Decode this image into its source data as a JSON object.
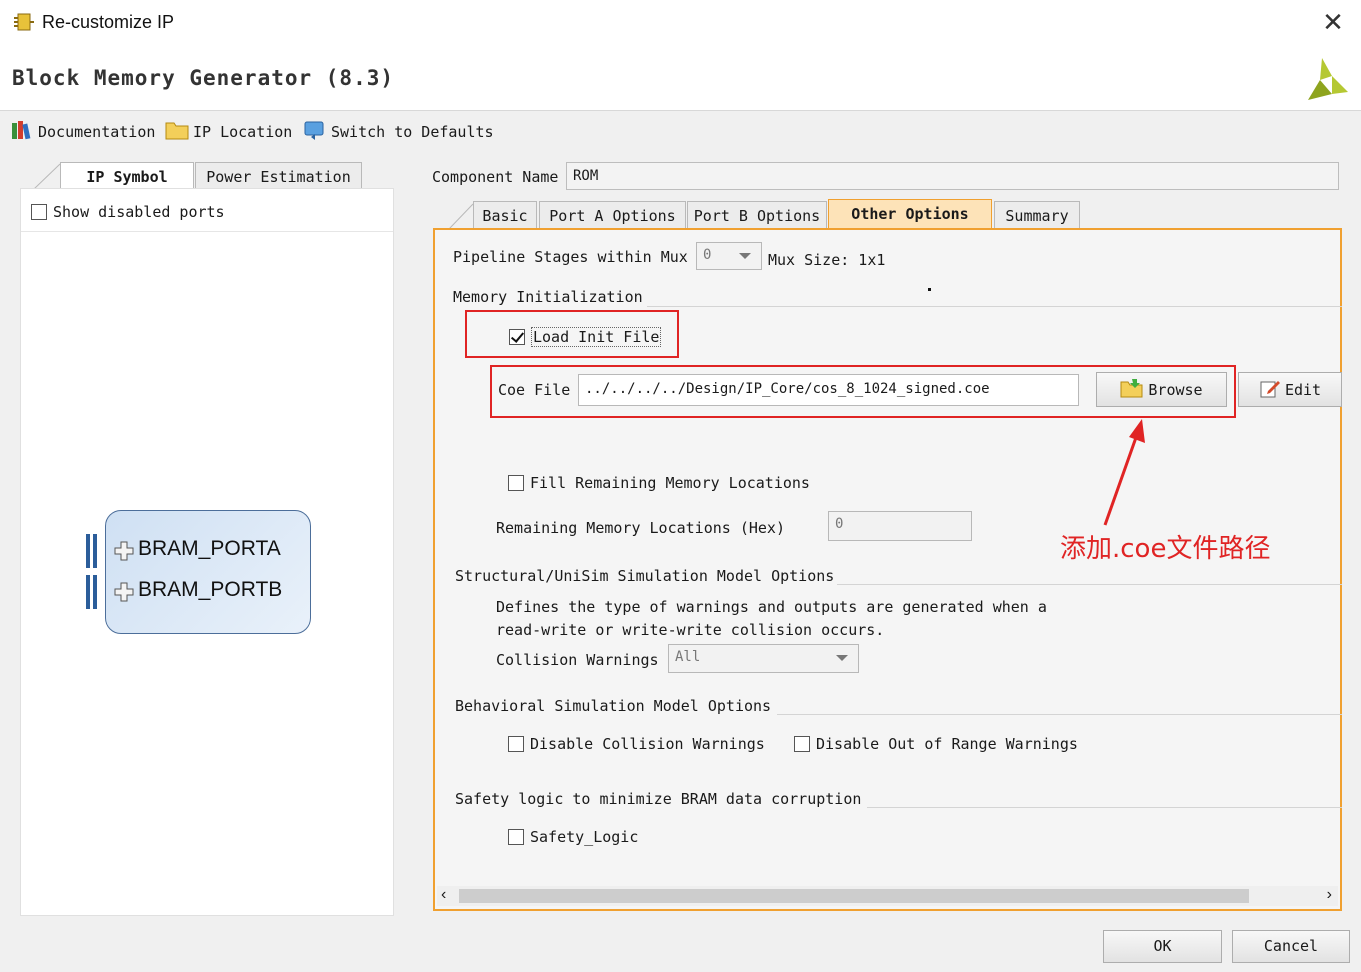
{
  "window": {
    "title": "Re-customize IP",
    "close_glyph": "✕"
  },
  "header": {
    "title": "Block Memory Generator (8.3)"
  },
  "toolbar": {
    "documentation": "Documentation",
    "ip_location": "IP Location",
    "switch_defaults": "Switch to Defaults"
  },
  "left": {
    "tabs": [
      "IP Symbol",
      "Power Estimation"
    ],
    "show_disabled_ports": {
      "label": "Show disabled ports",
      "checked": false
    },
    "ports": [
      "BRAM_PORTA",
      "BRAM_PORTB"
    ]
  },
  "component": {
    "label": "Component Name",
    "value": "ROM"
  },
  "tabs": [
    "Basic",
    "Port A Options",
    "Port B Options",
    "Other Options",
    "Summary"
  ],
  "active_tab": "Other Options",
  "options": {
    "pipeline_label": "Pipeline Stages within Mux",
    "pipeline_value": "0",
    "mux_size": "Mux Size: 1x1",
    "mem_init_title": "Memory Initialization",
    "load_init_file": {
      "label": "Load Init File",
      "checked": true
    },
    "coe_label": "Coe File",
    "coe_value": "../../../../Design/IP_Core/cos_8_1024_signed.coe",
    "browse": "Browse",
    "edit": "Edit",
    "fill_remaining": {
      "label": "Fill Remaining Memory Locations",
      "checked": false
    },
    "remaining_label": "Remaining Memory Locations (Hex)",
    "remaining_value": "0",
    "struct_title": "Structural/UniSim Simulation Model Options",
    "struct_desc_1": "Defines the type of warnings and outputs are generated when a",
    "struct_desc_2": "read-write or write-write collision occurs.",
    "collision_label": "Collision Warnings",
    "collision_value": "All",
    "behav_title": "Behavioral Simulation Model Options",
    "disable_collision": {
      "label": "Disable Collision Warnings",
      "checked": false
    },
    "disable_out_of_range": {
      "label": "Disable Out of Range Warnings",
      "checked": false
    },
    "safety_title": "Safety logic to minimize BRAM data corruption",
    "safety_logic": {
      "label": "Safety_Logic",
      "checked": false
    }
  },
  "annotation": {
    "text": "添加.coe文件路径",
    "color": "#e02424"
  },
  "footer": {
    "ok": "OK",
    "cancel": "Cancel"
  },
  "colors": {
    "accent_orange": "#f0a030",
    "annotation_red": "#e02424",
    "block_border": "#4c6e9a"
  }
}
